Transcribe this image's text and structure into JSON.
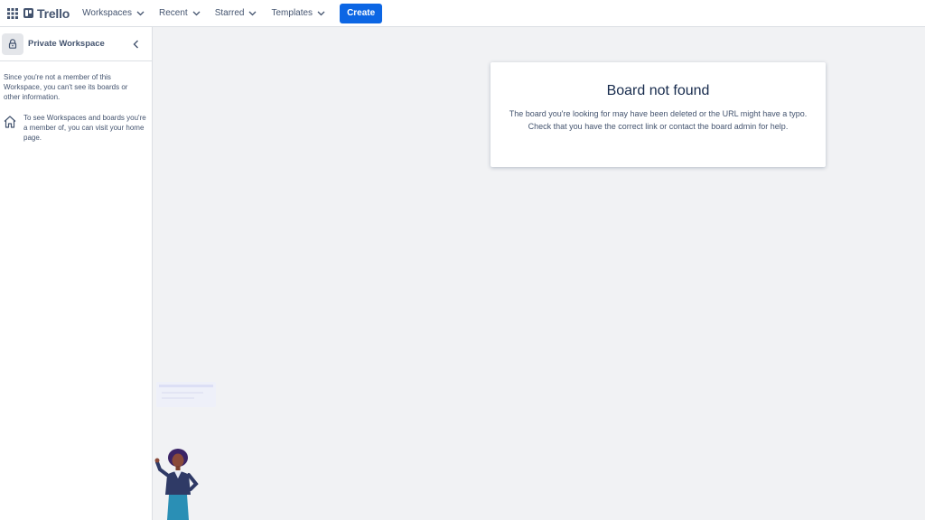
{
  "header": {
    "apps_icon": "grid-icon",
    "logo_text": "Trello",
    "nav": [
      {
        "label": "Workspaces",
        "icon": "chevron-down-icon"
      },
      {
        "label": "Recent",
        "icon": "chevron-down-icon"
      },
      {
        "label": "Starred",
        "icon": "chevron-down-icon"
      },
      {
        "label": "Templates",
        "icon": "chevron-down-icon"
      }
    ],
    "create_label": "Create"
  },
  "sidebar": {
    "workspace_title": "Private Workspace",
    "workspace_icon": "lock-icon",
    "collapse_icon": "chevron-left-icon",
    "note": "Since you're not a member of this Workspace, you can't see its boards or other information.",
    "home_icon": "home-icon",
    "home_text": "To see Workspaces and boards you're a member of, you can visit your home page."
  },
  "main": {
    "title": "Board not found",
    "message": "The board you're looking for may have been deleted or the URL might have a typo. Check that you have the correct link or contact the board admin for help."
  },
  "colors": {
    "primary": "#0c66e4",
    "text": "#172b4d",
    "subtle_text": "#44546f",
    "background": "#f1f2f4",
    "surface": "#ffffff",
    "border": "#dcdfe4"
  }
}
